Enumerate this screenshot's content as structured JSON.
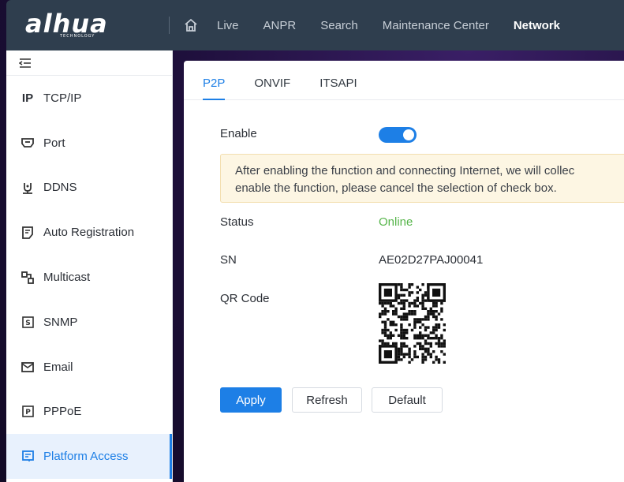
{
  "header": {
    "brand": "alhua",
    "brand_sub": "TECHNOLOGY",
    "nav": [
      "Live",
      "ANPR",
      "Search",
      "Maintenance Center",
      "Network"
    ],
    "active_nav": "Network",
    "home_icon": "home-icon"
  },
  "sidebar": {
    "collapse_icon": "menu-collapse-icon",
    "items": [
      {
        "label": "TCP/IP",
        "icon": "ip-icon"
      },
      {
        "label": "Port",
        "icon": "port-icon"
      },
      {
        "label": "DDNS",
        "icon": "ddns-icon"
      },
      {
        "label": "Auto Registration",
        "icon": "auto-registration-icon"
      },
      {
        "label": "Multicast",
        "icon": "multicast-icon"
      },
      {
        "label": "SNMP",
        "icon": "snmp-icon"
      },
      {
        "label": "Email",
        "icon": "email-icon"
      },
      {
        "label": "PPPoE",
        "icon": "pppoe-icon"
      },
      {
        "label": "Platform Access",
        "icon": "platform-access-icon"
      }
    ],
    "active_item": "Platform Access"
  },
  "main": {
    "tabs": [
      "P2P",
      "ONVIF",
      "ITSAPI"
    ],
    "active_tab": "P2P",
    "enable_label": "Enable",
    "enable_value": true,
    "notice_line1": "After enabling the function and connecting Internet, we will collec",
    "notice_line2": "enable the function, please cancel the selection of check box.",
    "status_label": "Status",
    "status_value": "Online",
    "sn_label": "SN",
    "sn_value": "AE02D27PAJ00041",
    "qr_label": "QR Code",
    "buttons": {
      "apply": "Apply",
      "refresh": "Refresh",
      "default": "Default"
    }
  },
  "colors": {
    "accent": "#1d7fe6",
    "header_bg": "#2f3e4e",
    "online": "#56b54a",
    "notice_bg": "#fdf6e3"
  }
}
